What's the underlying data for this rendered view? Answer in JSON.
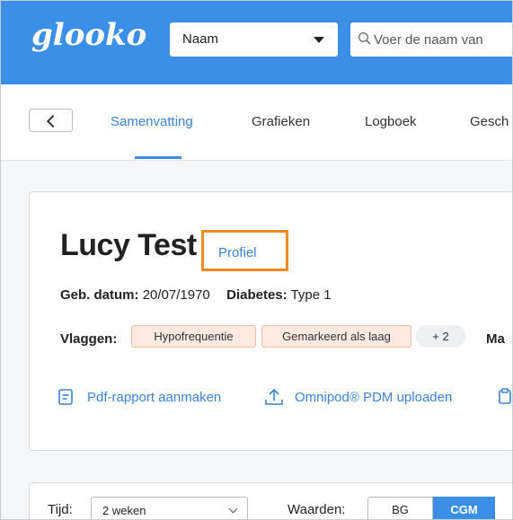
{
  "header": {
    "logo": "glooko",
    "search_by": "Naam",
    "search_placeholder": "Voer de naam van"
  },
  "nav": {
    "tabs": [
      {
        "label": "Samenvatting",
        "active": true
      },
      {
        "label": "Grafieken",
        "active": false
      },
      {
        "label": "Logboek",
        "active": false
      },
      {
        "label": "Gesch",
        "active": false
      }
    ]
  },
  "patient": {
    "name": "Lucy Test",
    "profile_link": "Profiel",
    "dob_label": "Geb. datum:",
    "dob_value": "20/07/1970",
    "diabetes_label": "Diabetes:",
    "diabetes_value": "Type 1",
    "flags_label": "Vlaggen:",
    "flags": [
      "Hypofrequentie",
      "Gemarkeerd als laag"
    ],
    "flags_more": "+ 2",
    "next_label": "Ma"
  },
  "actions": {
    "pdf": "Pdf-rapport aanmaken",
    "upload": "Omnipod® PDM uploaden"
  },
  "filters": {
    "time_label": "Tijd:",
    "time_value": "2 weken",
    "values_label": "Waarden:",
    "values_options": [
      "BG",
      "CGM"
    ],
    "values_selected": "CGM"
  },
  "colors": {
    "brand_blue": "#3b8fe6",
    "highlight_orange": "#f28b1e",
    "flag_bg": "#fde9e0"
  }
}
